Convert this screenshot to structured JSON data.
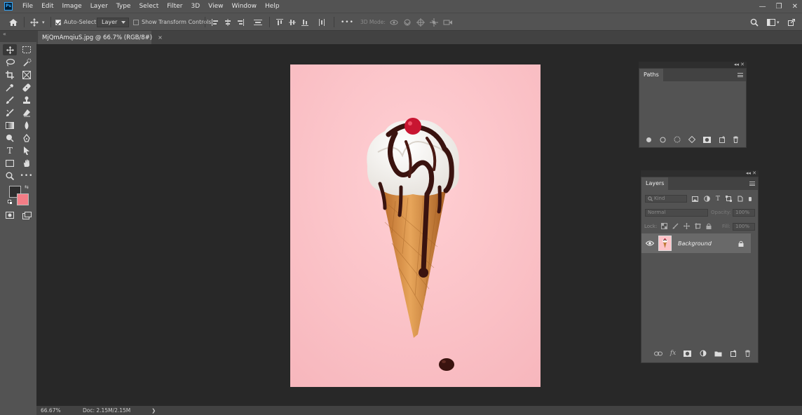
{
  "app": {
    "logo": "Ps"
  },
  "menu": [
    "File",
    "Edit",
    "Image",
    "Layer",
    "Type",
    "Select",
    "Filter",
    "3D",
    "View",
    "Window",
    "Help"
  ],
  "window_controls": {
    "minimize": "—",
    "restore": "❐",
    "close": "✕"
  },
  "options_bar": {
    "auto_select_label": "Auto-Select:",
    "auto_select_checked": true,
    "auto_select_target": "Layer",
    "show_transform_label": "Show Transform Controls",
    "show_transform_checked": false,
    "mode_3d_label": "3D Mode:",
    "more_label": "•••"
  },
  "document_tab": {
    "title": "MjQmAmqiuS.jpg @ 66.7% (RGB/8#)",
    "close": "×"
  },
  "toolbar": {
    "collapse": "«",
    "tools": [
      "move-tool",
      "rectangular-marquee-tool",
      "lasso-tool",
      "quick-selection-tool",
      "crop-tool",
      "frame-tool",
      "eyedropper-tool",
      "spot-healing-brush-tool",
      "brush-tool",
      "clone-stamp-tool",
      "history-brush-tool",
      "eraser-tool",
      "gradient-tool",
      "blur-tool",
      "dodge-tool",
      "pen-tool",
      "type-tool",
      "path-selection-tool",
      "rectangle-tool",
      "hand-tool",
      "zoom-tool",
      "edit-toolbar"
    ],
    "foreground_color": "#2d2d2d",
    "background_color": "#f47d86"
  },
  "status": {
    "zoom": "66.67%",
    "doc": "Doc: 2.15M/2.15M",
    "arrow": "❯"
  },
  "paths_panel": {
    "top_icons": "◂◂ ✕",
    "tab": "Paths",
    "footer_icons": [
      "fill-path-icon",
      "stroke-path-icon",
      "load-selection-icon",
      "make-work-path-icon",
      "add-mask-icon",
      "new-path-icon",
      "delete-path-icon"
    ]
  },
  "layers_panel": {
    "top_icons": "◂◂ ✕",
    "tab": "Layers",
    "filter_placeholder": "Kind",
    "blend_mode": "Normal",
    "opacity_label": "Opacity:",
    "opacity_value": "100%",
    "lock_label": "Lock:",
    "fill_label": "Fill:",
    "fill_value": "100%",
    "layers": [
      {
        "name": "Background",
        "visible": true,
        "locked": true
      }
    ],
    "footer_icons": [
      "link-layers-icon",
      "fx-icon",
      "add-layer-mask-icon",
      "adjustment-layer-icon",
      "group-icon",
      "new-layer-icon",
      "delete-layer-icon"
    ],
    "fx_label": "fx"
  },
  "colors": {
    "accent": "#31a8ff",
    "canvas_bg": "#fcc3c8"
  }
}
